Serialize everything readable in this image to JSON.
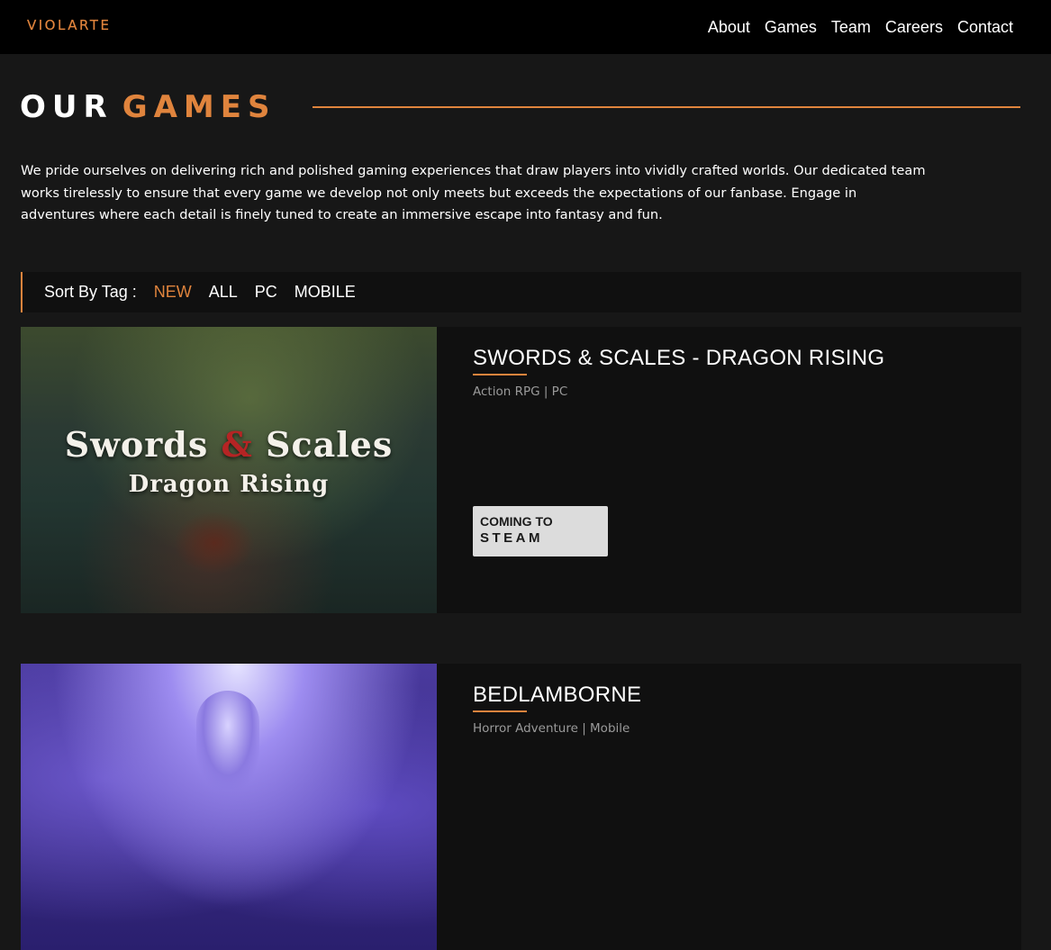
{
  "header": {
    "logo": "VIOLARTE",
    "nav": [
      "About",
      "Games",
      "Team",
      "Careers",
      "Contact"
    ]
  },
  "page": {
    "title_part1": "OUR",
    "title_part2": "GAMES",
    "intro": "We pride ourselves on delivering rich and polished gaming experiences that draw players into vividly crafted worlds. Our dedicated team works tirelessly to ensure that every game we develop not only meets but exceeds the expectations of our fanbase. Engage in adventures where each detail is finely tuned to create an immersive escape into fantasy and fun."
  },
  "sort": {
    "label": "Sort By Tag :",
    "tags": [
      "NEW",
      "ALL",
      "PC",
      "MOBILE"
    ],
    "active": "NEW"
  },
  "games": [
    {
      "title": "SWORDS & SCALES - DRAGON RISING",
      "meta": "Action RPG | PC",
      "cover_line1_a": "Swords",
      "cover_amp": "&",
      "cover_line1_b": "Scales",
      "cover_line2": "Dragon Rising",
      "button_line1": "COMING TO",
      "button_line2": "STEAM"
    },
    {
      "title": "BEDLAMBORNE",
      "meta": "Horror Adventure | Mobile"
    }
  ],
  "colors": {
    "accent": "#e0843d",
    "background": "#171717",
    "header": "#000000",
    "card": "#101010"
  }
}
